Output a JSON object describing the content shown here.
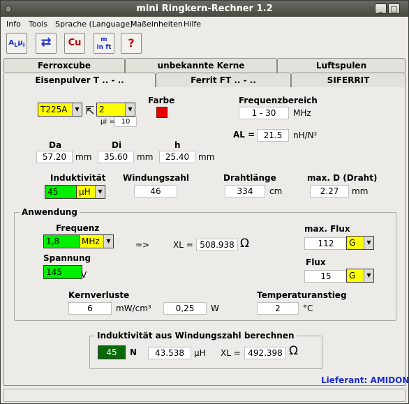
{
  "window": {
    "title": "mini Ringkern-Rechner 1.2",
    "min_icon": "minimize-icon",
    "max_icon": "maximize-icon",
    "close_icon": "close-icon"
  },
  "menu": {
    "items": [
      {
        "label": "Info"
      },
      {
        "label": "Tools"
      },
      {
        "label": "Sprache (Language)"
      },
      {
        "label": "Maßeinheiten"
      },
      {
        "label": "Hilfe"
      }
    ]
  },
  "toolbar": {
    "buttons": [
      {
        "icon": "inductance-calc-icon",
        "text": "Aₗ μᵢ"
      },
      {
        "icon": "core-switch-icon",
        "text": "⇄"
      },
      {
        "icon": "copper-wire-icon",
        "text": "Cu"
      },
      {
        "icon": "unit-convert-icon",
        "text": "m in ft"
      },
      {
        "icon": "help-icon",
        "text": "?"
      }
    ]
  },
  "tabs": {
    "row1": [
      "Ferroxcube",
      "unbekannte Kerne",
      "Luftspulen"
    ],
    "row2": [
      "Eisenpulver T .. - ..",
      "Ferrit FT .. - ..",
      "SIFERRIT"
    ]
  },
  "core": {
    "type_value": "T225A",
    "material_value": "2",
    "mu_label": "µi =",
    "mu_value": "10",
    "farbe_label": "Farbe",
    "farbe_color": "#e60000",
    "freq_range_label": "Frequenzbereich",
    "freq_range_value": "1 - 30",
    "freq_range_unit": "MHz",
    "al_label": "AL =",
    "al_value": "21.5",
    "al_unit": "nH/N²"
  },
  "dims": {
    "da_label": "Da",
    "da_value": "57.20",
    "da_unit": "mm",
    "di_label": "Di",
    "di_value": "35.60",
    "di_unit": "mm",
    "h_label": "h",
    "h_value": "25.40",
    "h_unit": "mm"
  },
  "winding": {
    "induktivitaet_label": "Induktivität",
    "induktivitaet_value": "45",
    "induktivitaet_unit": "µH",
    "windungszahl_label": "Windungszahl",
    "windungszahl_value": "46",
    "drahtlaenge_label": "Drahtlänge",
    "drahtlaenge_value": "334",
    "drahtlaenge_unit": "cm",
    "maxd_label": "max. D (Draht)",
    "maxd_value": "2.27",
    "maxd_unit": "mm"
  },
  "anwendung": {
    "title": "Anwendung",
    "frequenz_label": "Frequenz",
    "frequenz_value": "1,8",
    "frequenz_unit": "MHz",
    "arrow": "=>",
    "xl_label": "XL =",
    "xl_value": "508.938",
    "ohm": "Ω",
    "spannung_label": "Spannung",
    "spannung_value": "145",
    "spannung_unit": "V",
    "maxflux_label": "max. Flux",
    "maxflux_value": "112",
    "maxflux_unit": "G",
    "flux_label": "Flux",
    "flux_value": "15",
    "flux_unit": "G",
    "kernverluste_label": "Kernverluste",
    "kernverluste_value": "6",
    "kernverluste_unit": "mW/cm³",
    "watt_value": "0,25",
    "watt_unit": "W",
    "temp_label": "Temperaturanstieg",
    "temp_value": "2",
    "temp_unit": "°C"
  },
  "berechnen": {
    "title": "Induktivität aus Windungszahl berechnen",
    "n_value": "45",
    "n_unit": "N",
    "l_value": "43.538",
    "l_unit": "µH",
    "xl_label": "XL =",
    "xl_value": "492.398",
    "ohm": "Ω"
  },
  "footer": {
    "lieferant": "Lieferant: AMIDON"
  },
  "colors": {
    "accent_blue": "#1a2ecc",
    "green": "#00ee00",
    "yellow": "#ffff00",
    "dark_green": "#0a6a0a"
  }
}
